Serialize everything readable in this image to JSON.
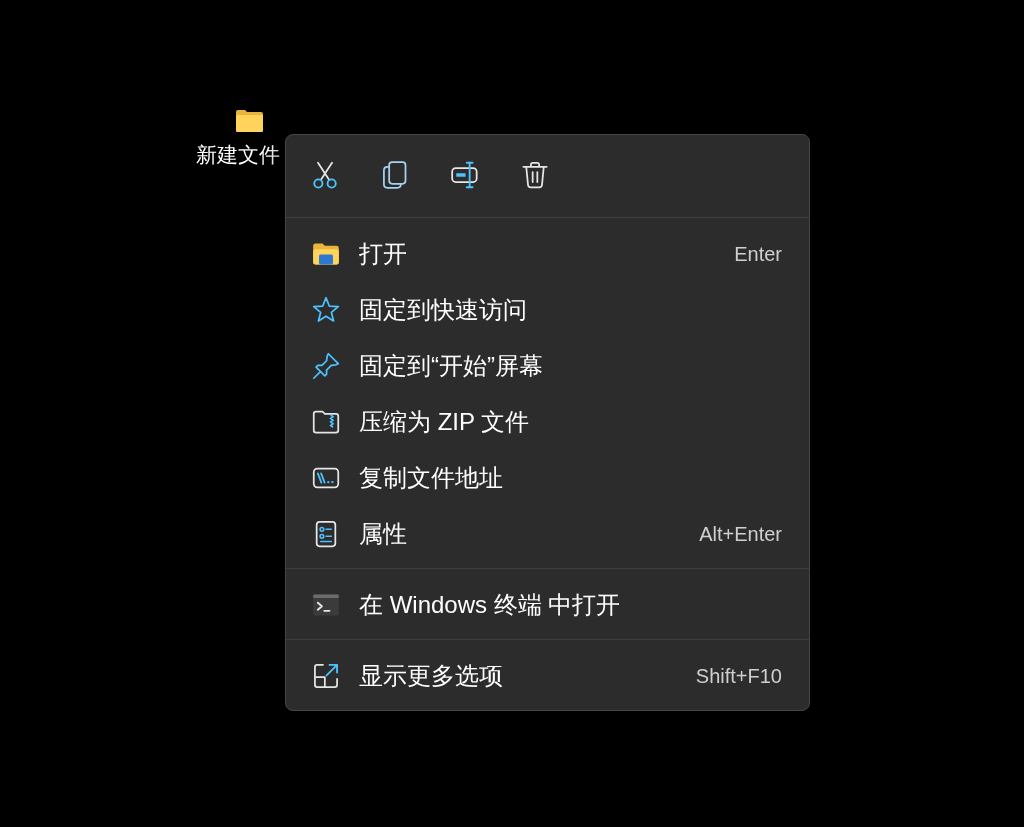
{
  "desktop_icon": {
    "label": "新建文件"
  },
  "context_menu": {
    "toolbar": [
      {
        "kind": "cut"
      },
      {
        "kind": "copy"
      },
      {
        "kind": "rename"
      },
      {
        "kind": "delete"
      }
    ],
    "sections": [
      {
        "items": [
          {
            "kind": "open",
            "label": "打开",
            "shortcut": "Enter"
          },
          {
            "kind": "pin-quick-access",
            "label": "固定到快速访问"
          },
          {
            "kind": "pin-start",
            "label": "固定到“开始”屏幕"
          },
          {
            "kind": "zip",
            "label": "压缩为 ZIP 文件"
          },
          {
            "kind": "copy-path",
            "label": "复制文件地址"
          },
          {
            "kind": "properties",
            "label": "属性",
            "shortcut": "Alt+Enter"
          }
        ]
      },
      {
        "items": [
          {
            "kind": "terminal",
            "label": "在 Windows 终端 中打开"
          }
        ]
      },
      {
        "items": [
          {
            "kind": "more",
            "label": "显示更多选项",
            "shortcut": "Shift+F10"
          }
        ]
      }
    ]
  }
}
